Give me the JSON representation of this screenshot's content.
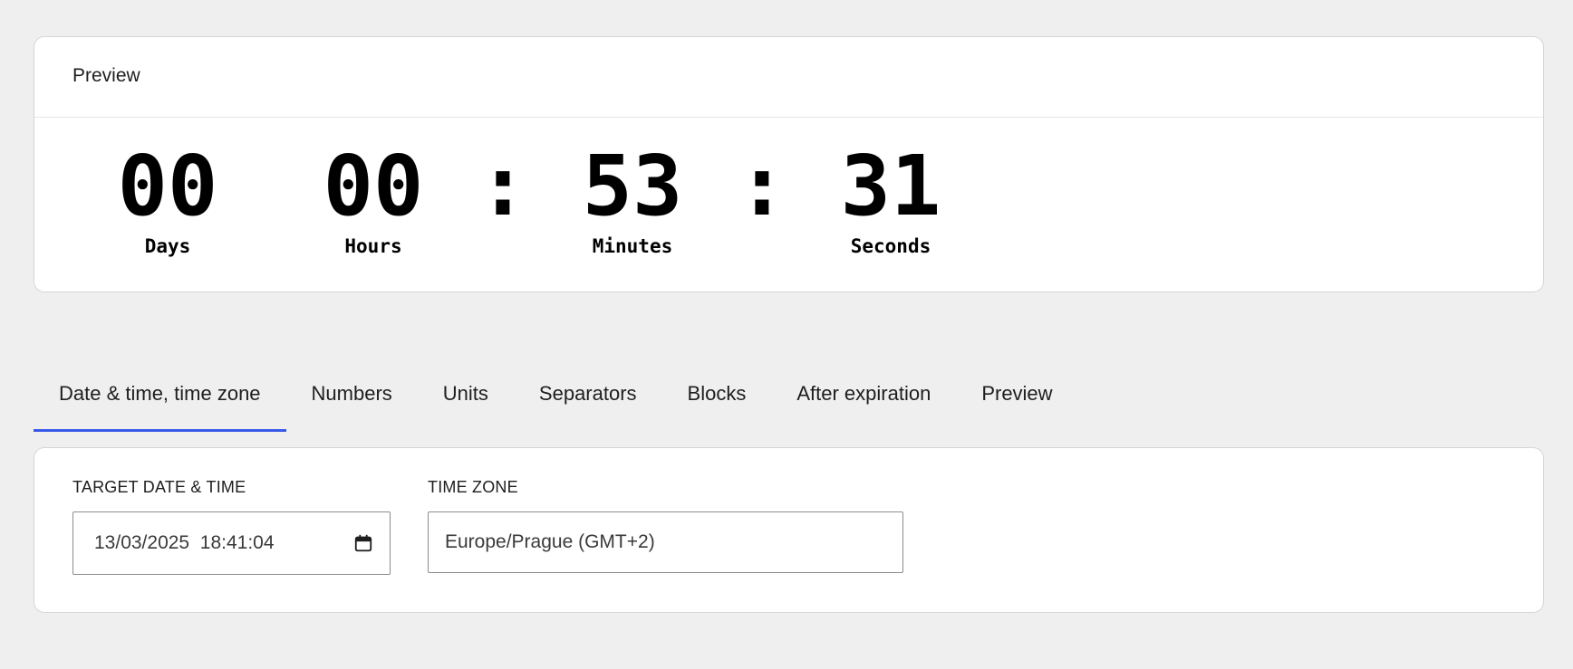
{
  "preview": {
    "title": "Preview",
    "countdown": [
      {
        "key": "days",
        "value": "00",
        "label": "Days"
      },
      {
        "key": "hours",
        "value": "00",
        "label": "Hours"
      },
      {
        "key": "minutes",
        "value": "53",
        "label": "Minutes"
      },
      {
        "key": "seconds",
        "value": "31",
        "label": "Seconds"
      }
    ],
    "separator": ":"
  },
  "tabs": [
    {
      "label": "Date & time, time zone",
      "active": true
    },
    {
      "label": "Numbers",
      "active": false
    },
    {
      "label": "Units",
      "active": false
    },
    {
      "label": "Separators",
      "active": false
    },
    {
      "label": "Blocks",
      "active": false
    },
    {
      "label": "After expiration",
      "active": false
    },
    {
      "label": "Preview",
      "active": false
    }
  ],
  "settings": {
    "target_date": {
      "label": "Target date & time",
      "value": "13/03/2025  18:41:04",
      "icon": "calendar-icon"
    },
    "time_zone": {
      "label": "Time zone",
      "value": "Europe/Prague (GMT+2)"
    }
  },
  "colors": {
    "accent": "#3858e9",
    "background": "#efefef",
    "card": "#ffffff"
  }
}
